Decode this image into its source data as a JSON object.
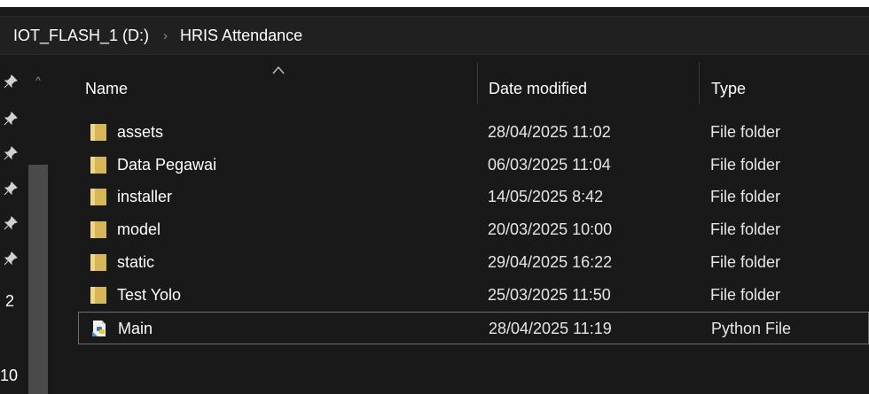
{
  "address": {
    "drive": "IOT_FLASH_1 (D:)",
    "separator": "›",
    "folder": "HRIS Attendance"
  },
  "nav": {
    "labels": [
      "2",
      "10"
    ]
  },
  "columns": {
    "name": "Name",
    "date": "Date modified",
    "type": "Type"
  },
  "sort": {
    "column": "Name",
    "direction": "ascending"
  },
  "files": [
    {
      "name": "assets",
      "date": "28/04/2025 11:02",
      "type": "File folder",
      "icon": "folder-icon"
    },
    {
      "name": "Data Pegawai",
      "date": "06/03/2025 11:04",
      "type": "File folder",
      "icon": "folder-icon"
    },
    {
      "name": "installer",
      "date": "14/05/2025 8:42",
      "type": "File folder",
      "icon": "folder-icon"
    },
    {
      "name": "model",
      "date": "20/03/2025 10:00",
      "type": "File folder",
      "icon": "folder-icon"
    },
    {
      "name": "static",
      "date": "29/04/2025 16:22",
      "type": "File folder",
      "icon": "folder-icon"
    },
    {
      "name": "Test Yolo",
      "date": "25/03/2025 11:50",
      "type": "File folder",
      "icon": "folder-icon"
    },
    {
      "name": "Main",
      "date": "28/04/2025 11:19",
      "type": "Python File",
      "icon": "python-file-icon"
    }
  ],
  "colors": {
    "background": "#191919",
    "folder": "#e8c76a",
    "text": "#ffffff"
  }
}
